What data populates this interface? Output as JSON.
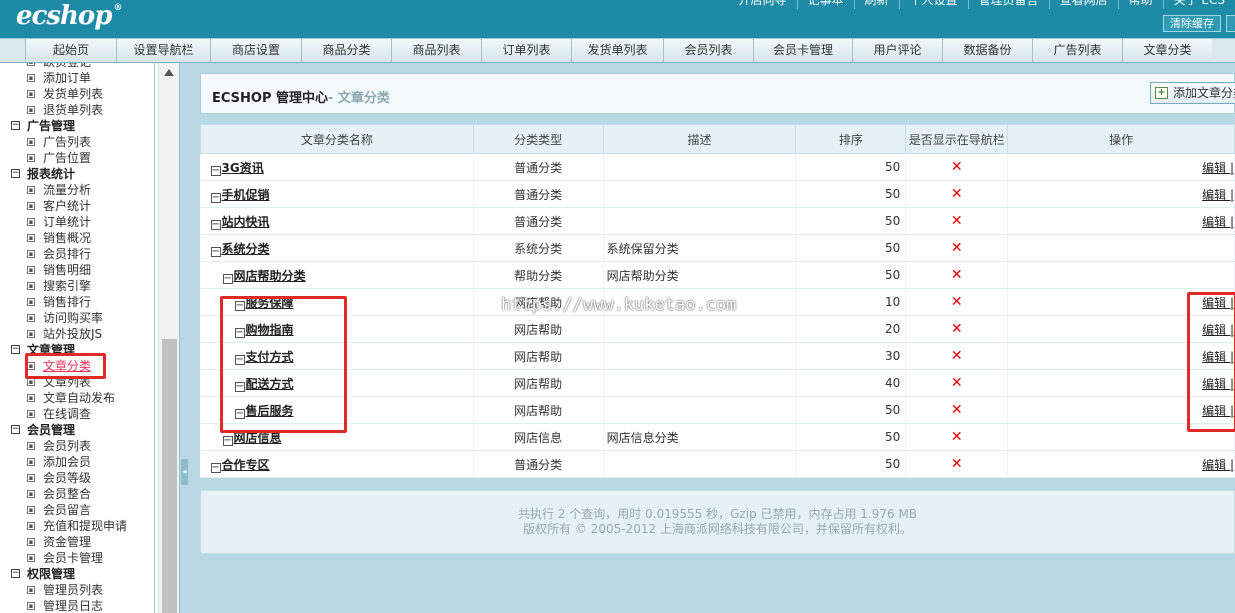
{
  "header": {
    "logo": "ecshop",
    "logo_mark": "®",
    "top_links": [
      "开店向导",
      "记事本",
      "刷新",
      "个人设置",
      "管理员留言",
      "查看网店",
      "帮助",
      "关于 ECS"
    ],
    "clear_cache": "清除缓存"
  },
  "nav_tabs": [
    "起始页",
    "设置导航栏",
    "商店设置",
    "商品分类",
    "商品列表",
    "订单列表",
    "发货单列表",
    "会员列表",
    "会员卡管理",
    "用户评论",
    "数据备份",
    "广告列表",
    "文章分类"
  ],
  "sidebar": {
    "groups": [
      {
        "title": "",
        "items": [
          "缺货登记",
          "添加订单",
          "发货单列表",
          "退货单列表"
        ]
      },
      {
        "title": "广告管理",
        "items": [
          "广告列表",
          "广告位置"
        ]
      },
      {
        "title": "报表统计",
        "items": [
          "流量分析",
          "客户统计",
          "订单统计",
          "销售概况",
          "会员排行",
          "销售明细",
          "搜索引擎",
          "销售排行",
          "访问购买率",
          "站外投放JS"
        ]
      },
      {
        "title": "文章管理",
        "items": [
          "文章分类",
          "文章列表",
          "文章自动发布",
          "在线调查"
        ]
      },
      {
        "title": "会员管理",
        "items": [
          "会员列表",
          "添加会员",
          "会员等级",
          "会员整合",
          "会员留言",
          "充值和提现申请",
          "资金管理",
          "会员卡管理"
        ]
      },
      {
        "title": "权限管理",
        "items": [
          "管理员列表",
          "管理员日志"
        ]
      }
    ]
  },
  "main": {
    "title": "ECSHOP 管理中心",
    "subtitle": "- 文章分类",
    "add_button": "添加文章分类",
    "columns": [
      "文章分类名称",
      "分类类型",
      "描述",
      "排序",
      "是否显示在导航栏",
      "操作"
    ],
    "rows": [
      {
        "name": "3G资讯",
        "type": "普通分类",
        "desc": "",
        "sort": "50",
        "nav": "✕",
        "op": "编辑 |"
      },
      {
        "name": "手机促销",
        "type": "普通分类",
        "desc": "",
        "sort": "50",
        "nav": "✕",
        "op": "编辑 |"
      },
      {
        "name": "站内快讯",
        "type": "普通分类",
        "desc": "",
        "sort": "50",
        "nav": "✕",
        "op": "编辑 |"
      },
      {
        "name": "系统分类",
        "type": "系统分类",
        "desc": "系统保留分类",
        "sort": "50",
        "nav": "✕",
        "op": ""
      },
      {
        "name": "网店帮助分类",
        "type": "帮助分类",
        "desc": "网店帮助分类",
        "sort": "50",
        "nav": "✕",
        "op": ""
      },
      {
        "name": "服务保障",
        "type": "网店帮助",
        "desc": "",
        "sort": "10",
        "nav": "✕",
        "op": "编辑 |"
      },
      {
        "name": "购物指南",
        "type": "网店帮助",
        "desc": "",
        "sort": "20",
        "nav": "✕",
        "op": "编辑 |"
      },
      {
        "name": "支付方式",
        "type": "网店帮助",
        "desc": "",
        "sort": "30",
        "nav": "✕",
        "op": "编辑 |"
      },
      {
        "name": "配送方式",
        "type": "网店帮助",
        "desc": "",
        "sort": "40",
        "nav": "✕",
        "op": "编辑 |"
      },
      {
        "name": "售后服务",
        "type": "网店帮助",
        "desc": "",
        "sort": "50",
        "nav": "✕",
        "op": "编辑 |"
      },
      {
        "name": "网店信息",
        "type": "网店信息",
        "desc": "网店信息分类",
        "sort": "50",
        "nav": "✕",
        "op": ""
      },
      {
        "name": "合作专区",
        "type": "普通分类",
        "desc": "",
        "sort": "50",
        "nav": "✕",
        "op": "编辑 |"
      }
    ],
    "watermark": "https://www.kuketao.com"
  },
  "footer": {
    "line1": "共执行 2 个查询，用时 0.019555 秒，Gzip 已禁用，内存占用 1.976 MB",
    "line2": "版权所有 © 2005-2012 上海商派网络科技有限公司，并保留所有权利。"
  },
  "colors": {
    "header_bg": "#1e8ba6",
    "main_bg": "#b8d9e4",
    "highlight": "#e02a2a",
    "nav_false": "#ee0000"
  },
  "icons": [
    "expand-box-icon",
    "leaf-box-icon",
    "tree-toggle-icon",
    "cross-icon",
    "add-page-icon",
    "scroll-up-icon",
    "collapse-left-icon"
  ]
}
